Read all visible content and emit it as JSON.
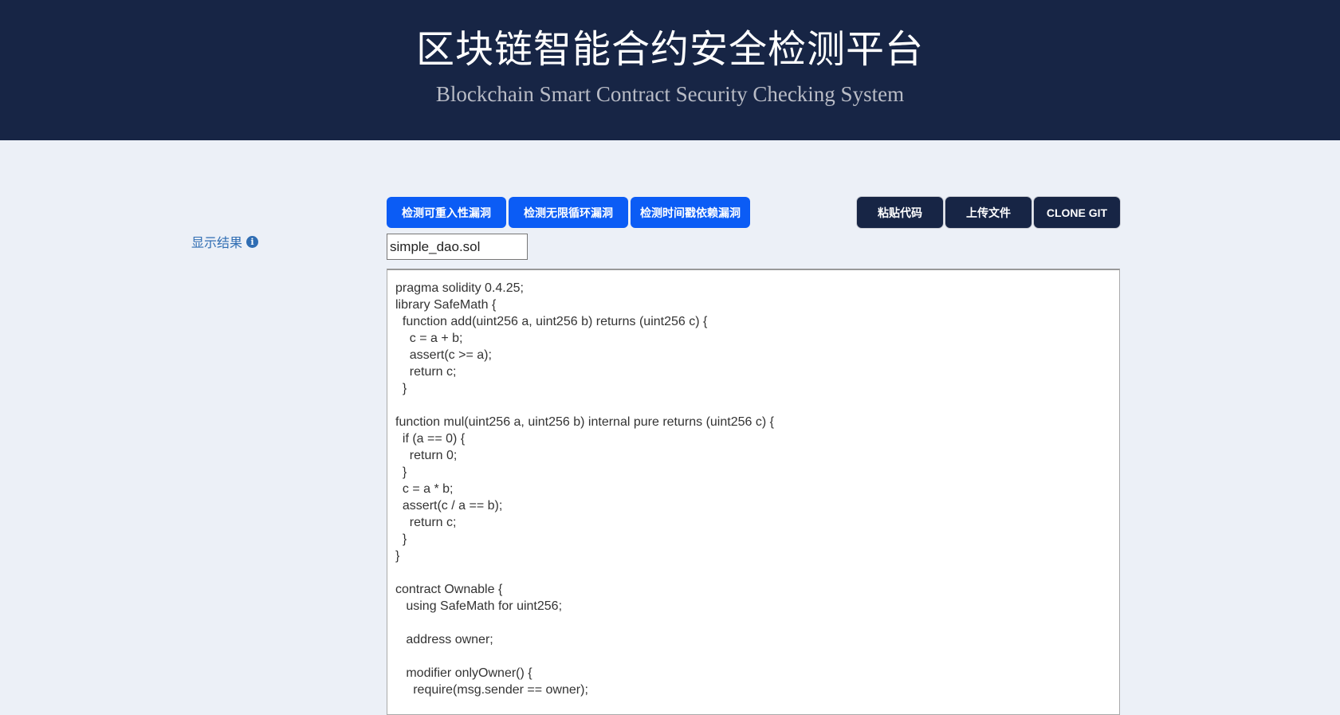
{
  "header": {
    "title": "区块链智能合约安全检测平台",
    "subtitle": "Blockchain Smart Contract Security Checking System"
  },
  "scan_buttons": [
    {
      "label": "检测可重入性漏洞"
    },
    {
      "label": "检测无限循环漏洞"
    },
    {
      "label": "检测时间戳依赖漏洞"
    }
  ],
  "source_buttons": [
    {
      "label": "粘贴代码"
    },
    {
      "label": "上传文件"
    },
    {
      "label": "CLONE GIT"
    }
  ],
  "result_label": "显示结果",
  "info_icon": "i",
  "filename": "simple_dao.sol",
  "code": "pragma solidity 0.4.25;\nlibrary SafeMath {\n  function add(uint256 a, uint256 b) returns (uint256 c) {\n    c = a + b;\n    assert(c >= a);\n    return c;\n  }\n\nfunction mul(uint256 a, uint256 b) internal pure returns (uint256 c) {\n  if (a == 0) {\n    return 0;\n  }\n  c = a * b;\n  assert(c / a == b);\n    return c;\n  }\n}\n\ncontract Ownable {\n   using SafeMath for uint256;\n\n   address owner;\n\n   modifier onlyOwner() {\n     require(msg.sender == owner);",
  "colors": {
    "header_bg": "#172545",
    "primary": "#0b5cf5",
    "page_bg": "#ecf0f7",
    "label": "#2f6db3"
  }
}
